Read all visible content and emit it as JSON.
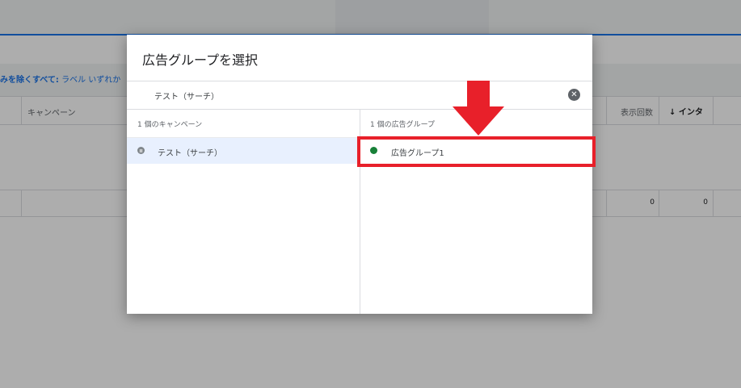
{
  "background": {
    "filter": {
      "bold_text": "みを除くすべて:",
      "text": " ラベル いずれか"
    },
    "table": {
      "columns": {
        "campaign": "キャンペーン",
        "impressions": "表示回数",
        "interactions": "↓ インタ"
      },
      "row": {
        "impressions": "0",
        "interactions": "0"
      }
    }
  },
  "dialog": {
    "title": "広告グループを選択",
    "search": {
      "value": "テスト（サーチ）",
      "clear_icon": "close-circle-icon"
    },
    "campaigns": {
      "header": "1 個のキャンペーン",
      "items": [
        {
          "label": "テスト（サーチ）",
          "status_icon": "paused-icon"
        }
      ]
    },
    "ad_groups": {
      "header": "1 個の広告グループ",
      "items": [
        {
          "label": "広告グループ1",
          "status_icon": "enabled-dot-icon"
        }
      ]
    }
  },
  "annotation": {
    "arrow_icon": "down-arrow-icon",
    "color": "#e8202a"
  }
}
